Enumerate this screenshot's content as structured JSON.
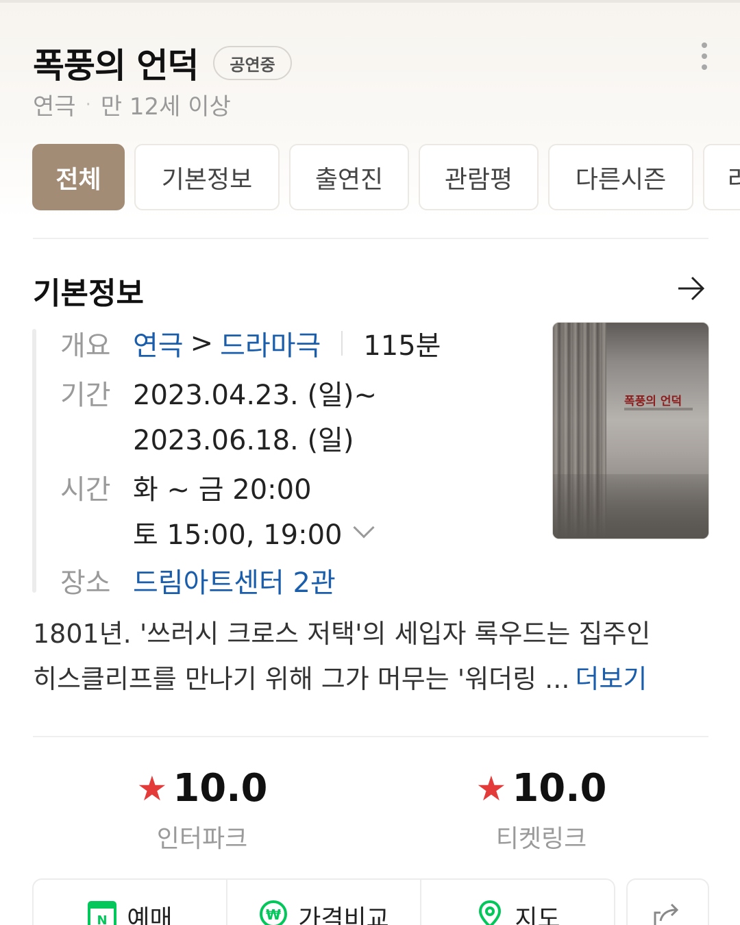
{
  "header": {
    "title": "폭풍의 언덕",
    "status_badge": "공연중",
    "genre": "연극",
    "age_rating": "만 12세 이상"
  },
  "tabs": [
    {
      "label": "전체",
      "active": true
    },
    {
      "label": "기본정보",
      "active": false
    },
    {
      "label": "출연진",
      "active": false
    },
    {
      "label": "관람평",
      "active": false
    },
    {
      "label": "다른시즌",
      "active": false
    },
    {
      "label": "라",
      "active": false
    }
  ],
  "basic_info": {
    "section_title": "기본정보",
    "overview": {
      "label": "개요",
      "category": "연극",
      "category_sep": ">",
      "subcategory": "드라마극",
      "runtime": "115분"
    },
    "period": {
      "label": "기간",
      "start": "2023.04.23. (일)~",
      "end": "2023.06.18. (일)"
    },
    "time": {
      "label": "시간",
      "line1": "화 ~ 금 20:00",
      "line2": "토 15:00, 19:00"
    },
    "venue": {
      "label": "장소",
      "value": "드림아트센터 2관"
    },
    "poster": {
      "title": "폭풍의 언덕"
    }
  },
  "synopsis": {
    "text_line1": "1801년. '쓰러시 크로스 저택'의 세입자 록우드는 집주인",
    "text_line2": "히스클리프를 만나기 위해 그가 머무는 '워더링 ...",
    "more_label": "더보기"
  },
  "ratings": [
    {
      "score": "10.0",
      "source": "인터파크"
    },
    {
      "score": "10.0",
      "source": "티켓링크"
    }
  ],
  "actions": [
    {
      "label": "예매",
      "icon": "calendar-n-icon"
    },
    {
      "label": "가격비교",
      "icon": "won-icon"
    },
    {
      "label": "지도",
      "icon": "map-pin-icon"
    }
  ],
  "colors": {
    "accent_tab": "#a38c76",
    "link": "#1a5dab",
    "star": "#e33a3a",
    "naver_green": "#03c75a"
  }
}
